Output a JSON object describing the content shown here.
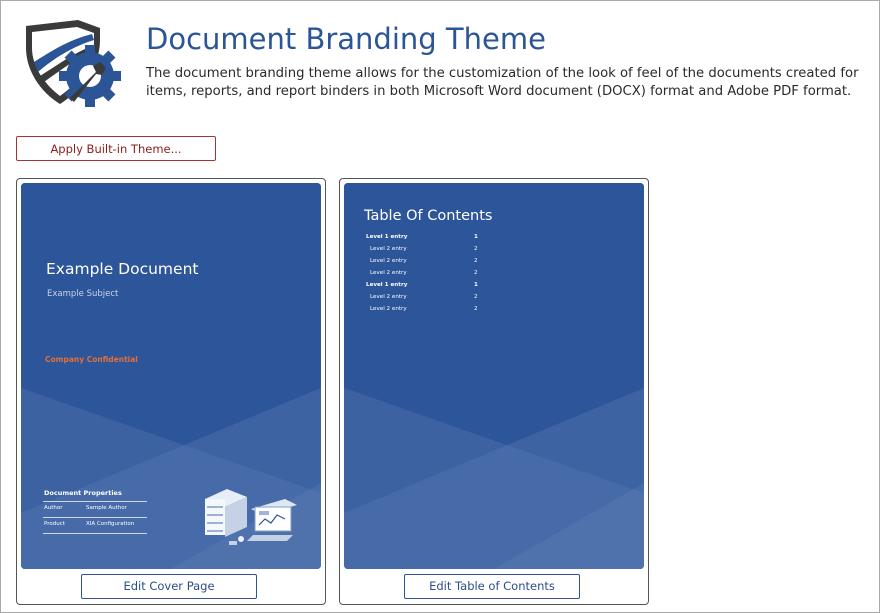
{
  "header": {
    "title": "Document Branding Theme",
    "description": "The document branding theme allows for the customization of the look of feel of the documents created for items, reports, and report binders in both Microsoft Word document (DOCX) format and Adobe PDF format."
  },
  "toolbar": {
    "apply_label": "Apply Built-in Theme..."
  },
  "cover_card": {
    "doc_title": "Example Document",
    "doc_subject": "Example Subject",
    "confidential": "Company Confidential",
    "properties_heading": "Document Properties",
    "properties": [
      {
        "key": "Author",
        "value": "Sample Author"
      },
      {
        "key": "Product",
        "value": "XIA Configuration"
      }
    ],
    "button_label": "Edit Cover Page"
  },
  "toc_card": {
    "title": "Table Of Contents",
    "entries": [
      {
        "label": "Level 1 entry",
        "page": "1",
        "level": 1
      },
      {
        "label": "Level 2 entry",
        "page": "2",
        "level": 2
      },
      {
        "label": "Level 2 entry",
        "page": "2",
        "level": 2
      },
      {
        "label": "Level 2 entry",
        "page": "2",
        "level": 2
      },
      {
        "label": "Level 1 entry",
        "page": "1",
        "level": 1
      },
      {
        "label": "Level 2 entry",
        "page": "2",
        "level": 2
      },
      {
        "label": "Level 2 entry",
        "page": "2",
        "level": 2
      }
    ],
    "button_label": "Edit Table of Contents"
  },
  "colors": {
    "title_blue": "#2b5596",
    "preview_blue": "#2d5599",
    "accent_orange": "#e2703a",
    "apply_border": "#a83232"
  },
  "icons": {
    "logo": "shield-gear-wrench-icon",
    "illustration": "servers-monitor-illustration"
  }
}
